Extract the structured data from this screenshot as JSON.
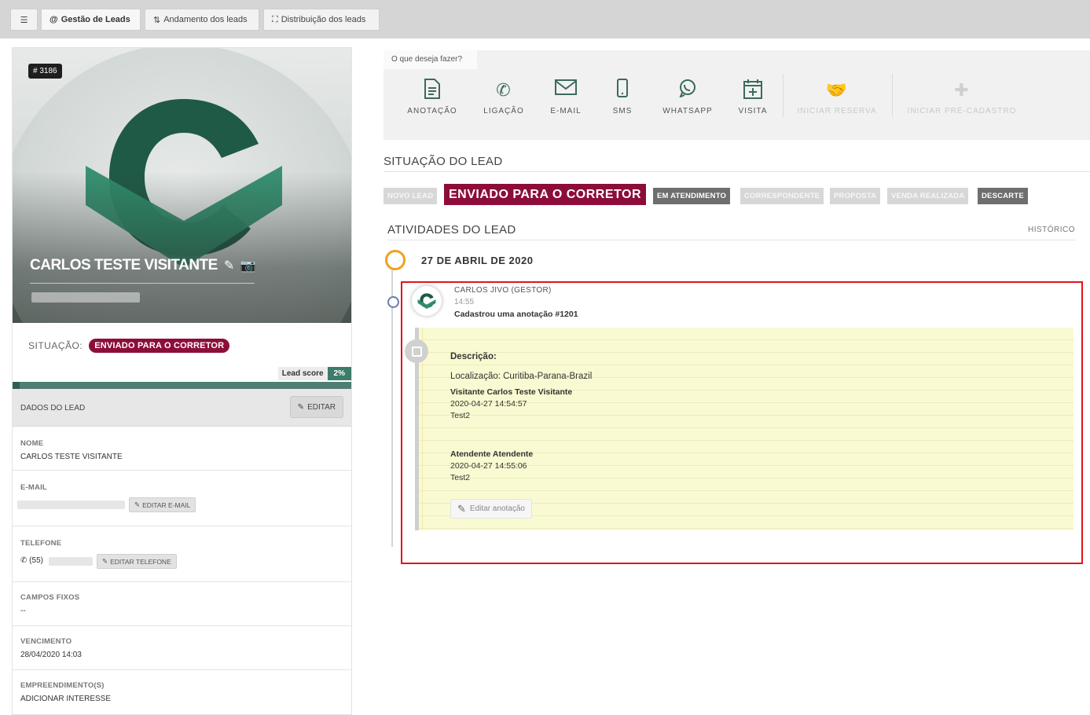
{
  "topbar": {
    "menu_icon": "hamburger-icon",
    "tabs": [
      {
        "label": "Gestão de Leads",
        "icon": "at-icon"
      },
      {
        "label": "Andamento dos leads",
        "icon": "sort-icon"
      },
      {
        "label": "Distribuição dos leads",
        "icon": "sitemap-icon"
      }
    ]
  },
  "lead": {
    "id_badge": "# 3186",
    "name": "CARLOS TESTE VISITANTE",
    "situacao_label": "SITUAÇÃO:",
    "situacao_value": "ENVIADO PARA O CORRETOR",
    "score_label": "Lead score",
    "score_value": "2%",
    "score_fraction": 0.02
  },
  "dados": {
    "title": "DADOS DO LEAD",
    "edit_label": "EDITAR",
    "fields": {
      "nome_label": "NOME",
      "nome_value": "CARLOS TESTE VISITANTE",
      "email_label": "E-MAIL",
      "email_edit": "EDITAR E-MAIL",
      "telefone_label": "TELEFONE",
      "telefone_prefix": "(55)",
      "telefone_edit": "EDITAR TELEFONE",
      "campos_label": "CAMPOS FIXOS",
      "campos_value": "--",
      "venc_label": "VENCIMENTO",
      "venc_value": "28/04/2020 14:03",
      "emp_label": "EMPREENDIMENTO(S)",
      "emp_value": "ADICIONAR INTERESSE"
    }
  },
  "actions": {
    "title": "O que deseja fazer?",
    "items": [
      {
        "label": "ANOTAÇÃO",
        "icon": "document-icon"
      },
      {
        "label": "LIGAÇÃO",
        "icon": "phone-icon"
      },
      {
        "label": "E-MAIL",
        "icon": "envelope-icon"
      },
      {
        "label": "SMS",
        "icon": "mobile-icon"
      },
      {
        "label": "WHATSAPP",
        "icon": "whatsapp-icon"
      },
      {
        "label": "VISITA",
        "icon": "calendar-plus-icon"
      },
      {
        "label": "INICIAR RESERVA",
        "icon": "handshake-icon"
      },
      {
        "label": "INICIAR PRÉ-CADASTRO",
        "icon": "plus-icon"
      }
    ]
  },
  "situacao": {
    "title": "SITUAÇÃO DO LEAD",
    "stages": [
      "NOVO LEAD",
      "ENVIADO PARA O CORRETOR",
      "EM ATENDIMENTO",
      "CORRESPONDENTE",
      "PROPOSTA",
      "VENDA REALIZADA",
      "DESCARTE"
    ]
  },
  "atividades": {
    "title": "ATIVIDADES DO LEAD",
    "historico": "HISTÓRICO",
    "date": "27 DE ABRIL DE 2020",
    "activity": {
      "author": "CARLOS JIVO (GESTOR)",
      "time": "14:55",
      "description": "Cadastrou uma anotação #1201"
    },
    "note": {
      "heading": "Descrição:",
      "location": "Localização: Curitiba-Parana-Brazil",
      "entry1_title": "Visitante Carlos Teste Visitante",
      "entry1_date": "2020-04-27 14:54:57",
      "entry1_text": "Test2",
      "entry2_title": "Atendente Atendente",
      "entry2_date": "2020-04-27 14:55:06",
      "entry2_text": "Test2",
      "edit_label": "Editar anotação"
    }
  },
  "colors": {
    "brand_green": "#2e7d5e",
    "stage_current": "#8d0d3a",
    "timeline_orange": "#f0a021",
    "highlight_red": "#e0141c",
    "note_yellow": "#fafad2"
  }
}
